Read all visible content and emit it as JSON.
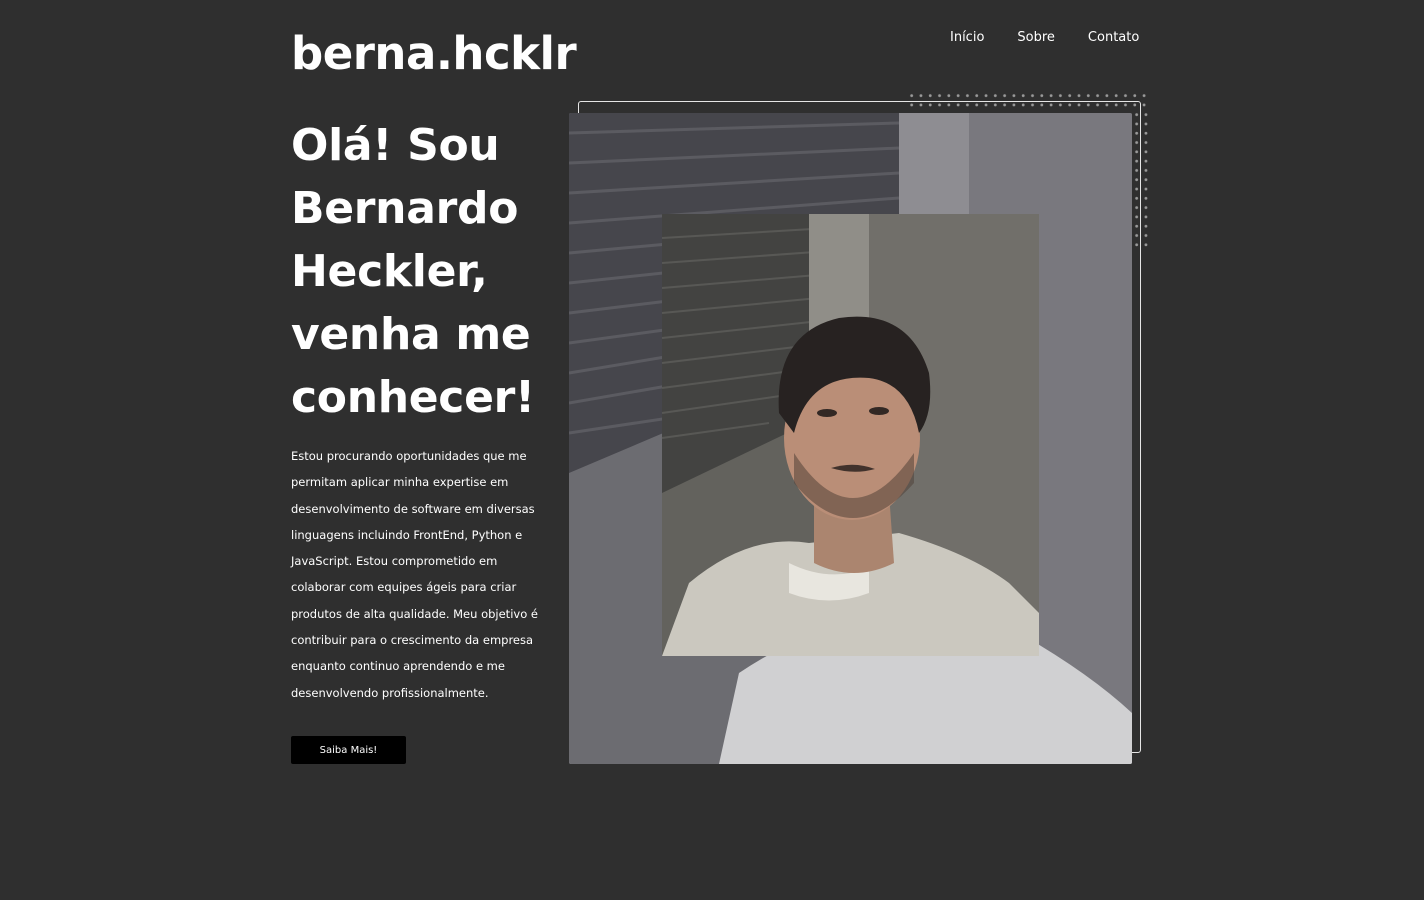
{
  "brand": {
    "logo": "berna.hcklr"
  },
  "nav": {
    "items": [
      "Início",
      "Sobre",
      "Contato"
    ]
  },
  "hero": {
    "title": "Olá! Sou Bernardo Heckler, venha me conhecer!",
    "description": "Estou procurando oportunidades que me permitam aplicar minha expertise em desenvolvimento de software em diversas linguagens incluindo FrontEnd, Python e JavaScript. Estou comprometido em colaborar com equipes ágeis para criar produtos de alta qualidade. Meu objetivo é contribuir para o crescimento da empresa enquanto continuo aprendendo e me desenvolvendo profissionalmente.",
    "cta_label": "Saiba Mais!"
  },
  "colors": {
    "background": "#2f2f2f",
    "text": "#ffffff",
    "button": "#000000"
  }
}
